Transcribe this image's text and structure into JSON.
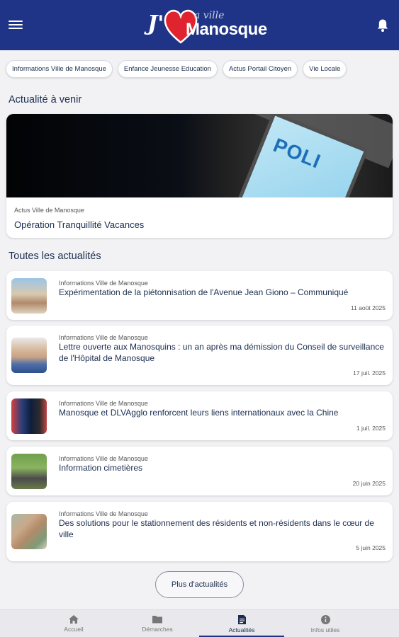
{
  "header": {
    "logo_prefix": "J'",
    "logo_small": "a ville",
    "logo_name": "Manosque",
    "menu_icon": "hamburger-menu-icon",
    "notification_icon": "bell-icon",
    "brand_color": "#1f3486",
    "heart_color": "#e0242f"
  },
  "chips": [
    {
      "label": "Informations Ville de Manosque"
    },
    {
      "label": "Enfance Jeunesse Education"
    },
    {
      "label": "Actus Portail Citoyen"
    },
    {
      "label": "Vie Locale"
    }
  ],
  "upcoming": {
    "heading": "Actualité à venir",
    "card": {
      "category": "Actus Ville de Manosque",
      "title": "Opération Tranquillité Vacances",
      "patch_text": "POLI"
    }
  },
  "all_news": {
    "heading": "Toutes les actualités",
    "items": [
      {
        "category": "Informations Ville de Manosque",
        "title": "Expérimentation de la piétonnisation de l'Avenue Jean Giono – Communiqué",
        "date": "11 août 2025"
      },
      {
        "category": "Informations Ville de Manosque",
        "title": "Lettre ouverte aux Manosquins : un an après ma démission du Conseil de surveillance de l'Hôpital de Manosque",
        "date": "17 juil. 2025"
      },
      {
        "category": "Informations Ville de Manosque",
        "title": "Manosque et DLVAgglo renforcent leurs liens internationaux avec la Chine",
        "date": "1 juil. 2025"
      },
      {
        "category": "Informations Ville de Manosque",
        "title": "Information cimetières",
        "date": "20 juin 2025"
      },
      {
        "category": "Informations Ville de Manosque",
        "title": "Des solutions pour le stationnement des résidents et non-résidents dans le cœur de ville",
        "date": "5 juin 2025"
      }
    ],
    "more_button": "Plus d'actualités"
  },
  "bottom_nav": [
    {
      "label": "Accueil",
      "icon": "home-icon",
      "active": false
    },
    {
      "label": "Démarches",
      "icon": "folder-icon",
      "active": false
    },
    {
      "label": "Actualités",
      "icon": "document-icon",
      "active": true
    },
    {
      "label": "Infos utiles",
      "icon": "info-icon",
      "active": false
    }
  ]
}
